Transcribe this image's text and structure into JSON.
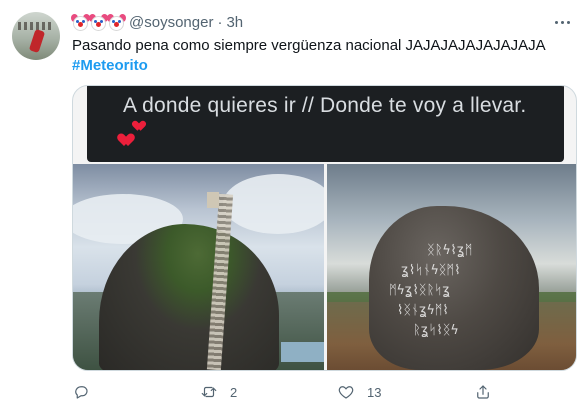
{
  "tweet": {
    "display_name_icon": "clown-face-emoji x3",
    "handle": "@soysonger",
    "separator": "·",
    "time": "3h",
    "text_line1": "Pasando pena como siempre vergüenza nacional JAJAJAJAJAJAJAJA",
    "hashtag": "#Meteorito"
  },
  "media": {
    "caption": "A donde quieres ir // Donde te voy a llevar.",
    "left_image": "photo of El Peñol rock with stairs",
    "right_image": "photo of rock covered in white painted symbols"
  },
  "actions": {
    "reply_count": "",
    "retweet_count": "2",
    "like_count": "13",
    "share_count": ""
  },
  "colors": {
    "link": "#1d9bf0",
    "secondary_text": "#536471",
    "heart": "#ec1f3b"
  }
}
